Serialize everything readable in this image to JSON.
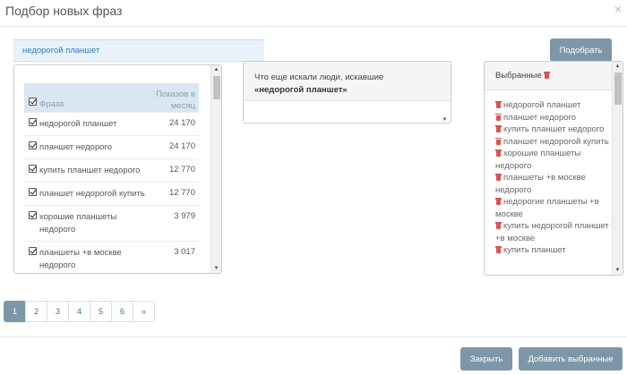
{
  "modal": {
    "title": "Подбор новых фраз",
    "close": "×"
  },
  "search": {
    "value": "недорогой планшет"
  },
  "buttons": {
    "pick": "Подобрать",
    "close": "Закрыть",
    "add_selected": "Добавить выбранные"
  },
  "phrases_table": {
    "col_phrase": "Фраза",
    "col_count": "Показов в месяц",
    "rows": [
      {
        "phrase": "недорогой планшет",
        "count": "24 170"
      },
      {
        "phrase": "планшет недорого",
        "count": "24 170"
      },
      {
        "phrase": "купить планшет недорого",
        "count": "12 770"
      },
      {
        "phrase": "планшет недорогой купить",
        "count": "12 770"
      },
      {
        "phrase": "хорошие планшеты недорого",
        "count": "3 979"
      },
      {
        "phrase": "планшеты +в москве недорого",
        "count": "3 017"
      }
    ]
  },
  "also_searched": {
    "prefix": "Что еще искали люди, искавшие",
    "query": "«недорогой планшет»"
  },
  "selected": {
    "title": "Выбранные",
    "items": [
      "недорогой планшет",
      "планшет недорого",
      "купить планшет недорого",
      "планшет недорогой купить",
      "хорошие планшеты недорого",
      "планшеты +в москве недорого",
      "недорогие планшеты +в москве",
      "купить недорогой планшет +в москве",
      "купить планшет"
    ]
  },
  "pagination": {
    "pages": [
      "1",
      "2",
      "3",
      "4",
      "5",
      "6",
      "»"
    ],
    "active": "1"
  }
}
